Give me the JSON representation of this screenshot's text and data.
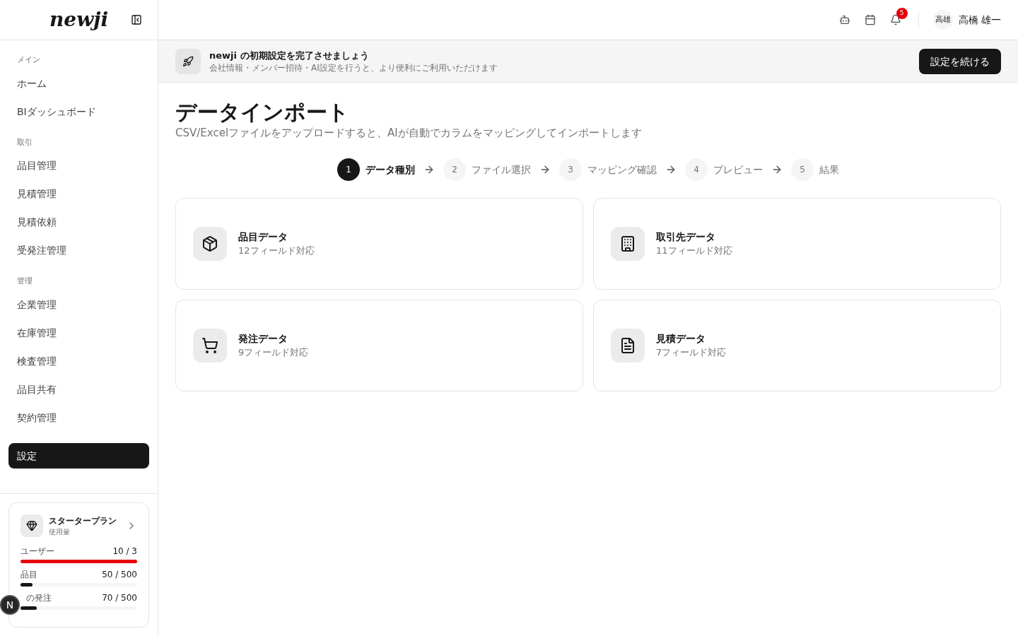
{
  "logo": "newji",
  "sidebar": {
    "sections": [
      {
        "title": "メイン",
        "items": [
          {
            "label": "ホーム",
            "selected": false
          },
          {
            "label": "BIダッシュボード",
            "selected": false
          }
        ]
      },
      {
        "title": "取引",
        "items": [
          {
            "label": "品目管理",
            "selected": false
          },
          {
            "label": "見積管理",
            "selected": false
          },
          {
            "label": "見積依頼",
            "selected": false
          },
          {
            "label": "受発注管理",
            "selected": false
          }
        ]
      },
      {
        "title": "管理",
        "items": [
          {
            "label": "企業管理",
            "selected": false
          },
          {
            "label": "在庫管理",
            "selected": false
          },
          {
            "label": "検査管理",
            "selected": false
          },
          {
            "label": "品目共有",
            "selected": false
          },
          {
            "label": "契約管理",
            "selected": false
          }
        ]
      }
    ],
    "settings": {
      "label": "設定",
      "selected": true
    },
    "plan": {
      "title": "スタータープラン",
      "subtitle": "使用量",
      "usage": [
        {
          "label": "ユーザー",
          "reading": "10 / 3",
          "level": 1.0,
          "color": "#e7000b"
        },
        {
          "label": "品目",
          "reading": "50 / 500",
          "level": 0.1,
          "color": "#171717"
        },
        {
          "label": "の発注",
          "reading": "70 / 500",
          "level": 0.14,
          "color": "#171717"
        }
      ]
    },
    "fab": "N"
  },
  "header": {
    "notification_count": "5",
    "avatar": "高雄",
    "user_name": "高橋 雄一"
  },
  "banner": {
    "title": "newji の初期設定を完了させましょう",
    "text": "会社情報・メンバー招待・AI設定を行うと、より便利にご利用いただけます",
    "button": "設定を続ける"
  },
  "page": {
    "title": "データインポート",
    "subtitle": "CSV/Excelファイルをアップロードすると、AIが自動でカラムをマッピングしてインポートします"
  },
  "steps": [
    {
      "number": "1",
      "label": "データ種別",
      "selected": true
    },
    {
      "number": "2",
      "label": "ファイル選択",
      "selected": false
    },
    {
      "number": "3",
      "label": "マッピング確認",
      "selected": false
    },
    {
      "number": "4",
      "label": "プレビュー",
      "selected": false
    },
    {
      "number": "5",
      "label": "結果",
      "selected": false
    }
  ],
  "cards": [
    {
      "kind": "package",
      "title": "品目データ",
      "text": "12フィールド対応"
    },
    {
      "kind": "building",
      "title": "取引先データ",
      "text": "11フィールド対応"
    },
    {
      "kind": "cart",
      "title": "発注データ",
      "text": "9フィールド対応"
    },
    {
      "kind": "document",
      "title": "見積データ",
      "text": "7フィールド対応"
    }
  ]
}
